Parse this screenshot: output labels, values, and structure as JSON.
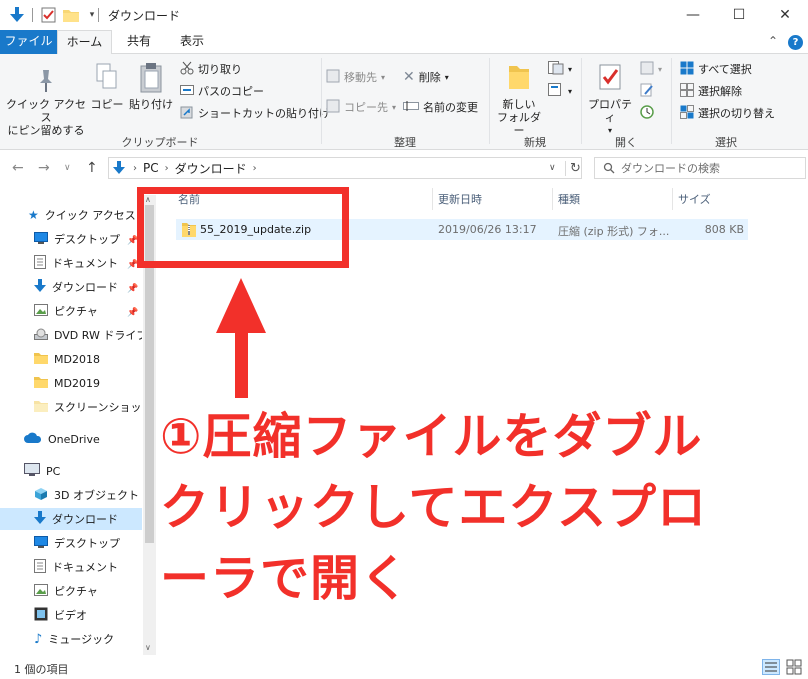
{
  "window": {
    "title": "ダウンロード",
    "controls": {
      "minimize": "—",
      "maximize": "☐",
      "close": "✕"
    }
  },
  "tabs": [
    {
      "label": "ファイル"
    },
    {
      "label": "ホーム"
    },
    {
      "label": "共有"
    },
    {
      "label": "表示"
    }
  ],
  "ribbon": {
    "clipboard": {
      "pin_quick_access": "クイック アクセス\nにピン留めする",
      "copy": "コピー",
      "paste": "貼り付け",
      "cut": "切り取り",
      "copy_path": "パスのコピー",
      "paste_shortcut": "ショートカットの貼り付け",
      "group_label": "クリップボード"
    },
    "organize": {
      "move_to": "移動先",
      "copy_to": "コピー先",
      "delete": "削除",
      "rename": "名前の変更",
      "group_label": "整理"
    },
    "new": {
      "new_folder": "新しい\nフォルダー",
      "group_label": "新規"
    },
    "open": {
      "properties": "プロパティ",
      "group_label": "開く"
    },
    "select": {
      "select_all": "すべて選択",
      "select_none": "選択解除",
      "invert_selection": "選択の切り替え",
      "group_label": "選択"
    }
  },
  "address_bar": {
    "breadcrumb": [
      "PC",
      "ダウンロード"
    ],
    "search_placeholder": "ダウンロードの検索"
  },
  "nav_pane": {
    "quick_access": "クイック アクセス",
    "items": [
      {
        "label": "デスクトップ",
        "pinned": true
      },
      {
        "label": "ドキュメント",
        "pinned": true
      },
      {
        "label": "ダウンロード",
        "pinned": true
      },
      {
        "label": "ピクチャ",
        "pinned": true
      },
      {
        "label": "DVD RW ドライブ ("
      },
      {
        "label": "MD2018"
      },
      {
        "label": "MD2019"
      },
      {
        "label": "スクリーンショット"
      }
    ],
    "onedrive": "OneDrive",
    "pc": "PC",
    "pc_items": [
      {
        "label": "3D オブジェクト"
      },
      {
        "label": "ダウンロード",
        "selected": true
      },
      {
        "label": "デスクトップ"
      },
      {
        "label": "ドキュメント"
      },
      {
        "label": "ピクチャ"
      },
      {
        "label": "ビデオ"
      },
      {
        "label": "ミュージック"
      }
    ]
  },
  "file_list": {
    "columns": [
      "名前",
      "更新日時",
      "種類",
      "サイズ"
    ],
    "rows": [
      {
        "name": "55_2019_update.zip",
        "modified": "2019/06/26 13:17",
        "type": "圧縮 (zip 形式) フォ...",
        "size": "808 KB"
      }
    ]
  },
  "status_bar": {
    "item_count": "1 個の項目"
  },
  "annotation": {
    "lines": [
      "①圧縮ファイルをダブル",
      "クリックしてエクスプロ",
      "ーラで開く"
    ],
    "color": "#f2302a"
  },
  "colors": {
    "accent": "#1979ca",
    "selection": "#cce8ff",
    "row_hover": "#e5f3ff"
  }
}
